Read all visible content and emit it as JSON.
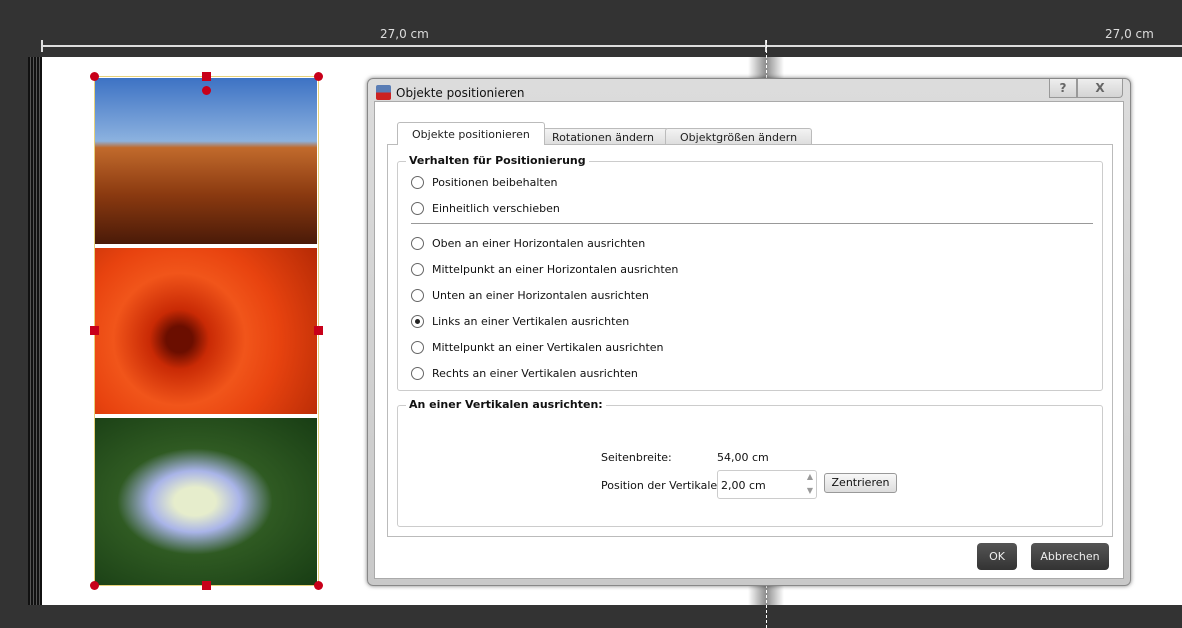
{
  "ruler": {
    "left_label": "27,0 cm",
    "right_label": "27,0 cm"
  },
  "dialog": {
    "title": "Objekte positionieren",
    "help_label": "?",
    "close_label": "X",
    "tabs": [
      {
        "label": "Objekte positionieren",
        "active": true
      },
      {
        "label": "Rotationen ändern",
        "active": false
      },
      {
        "label": "Objektgrößen ändern",
        "active": false
      }
    ],
    "behavior_group": {
      "title": "Verhalten für Positionierung",
      "options": [
        {
          "label": "Positionen beibehalten",
          "checked": false
        },
        {
          "label": "Einheitlich verschieben",
          "checked": false
        },
        {
          "label": "Oben an einer Horizontalen ausrichten",
          "checked": false
        },
        {
          "label": "Mittelpunkt an einer Horizontalen ausrichten",
          "checked": false
        },
        {
          "label": "Unten an einer Horizontalen ausrichten",
          "checked": false
        },
        {
          "label": "Links an einer Vertikalen ausrichten",
          "checked": true
        },
        {
          "label": "Mittelpunkt an einer Vertikalen ausrichten",
          "checked": false
        },
        {
          "label": "Rechts an einer Vertikalen ausrichten",
          "checked": false
        }
      ]
    },
    "align_group": {
      "title": "An einer Vertikalen ausrichten:",
      "page_width_label": "Seitenbreite:",
      "page_width_value": "54,00 cm",
      "position_label": "Position der Vertikalen:",
      "position_value": "2,00 cm",
      "center_button": "Zentrieren"
    },
    "ok_button": "OK",
    "cancel_button": "Abbrechen"
  },
  "colors": {
    "handle": "#c8001a",
    "background": "#333333",
    "button_dark": "#444444"
  }
}
